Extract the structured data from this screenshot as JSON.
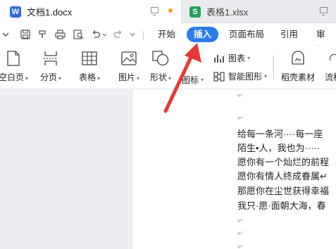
{
  "tabs": [
    {
      "title": "文档1.docx",
      "icon": "W",
      "type": "word",
      "active": true
    },
    {
      "title": "表格1.xlsx",
      "icon": "S",
      "type": "sheet",
      "active": false
    }
  ],
  "menu": {
    "tabs": [
      "开始",
      "插入",
      "页面布局",
      "引用",
      "审阅"
    ],
    "active": "插入"
  },
  "ribbon": {
    "blank_page": "空白页",
    "page_break": "分页",
    "table": "表格",
    "picture": "图片",
    "shape": "形状",
    "icon": "图标",
    "chart": "图表",
    "smart_art": "智能图形",
    "daoke": "稻壳素材",
    "flow": "流程"
  },
  "document": {
    "para_mark": "↵",
    "lines": [
      "给每一条河····每一座",
      "陌生•人，我也为·····",
      "愿你有一个灿烂的前程",
      "愿你有情人终成眷属↵",
      "那愿你在尘世获得幸福",
      "我只·愿·面朝大海，春"
    ]
  },
  "colors": {
    "accent": "#2b7de9",
    "arrow": "#e53935",
    "word": "#2f6fdf",
    "sheet": "#20a45b"
  }
}
